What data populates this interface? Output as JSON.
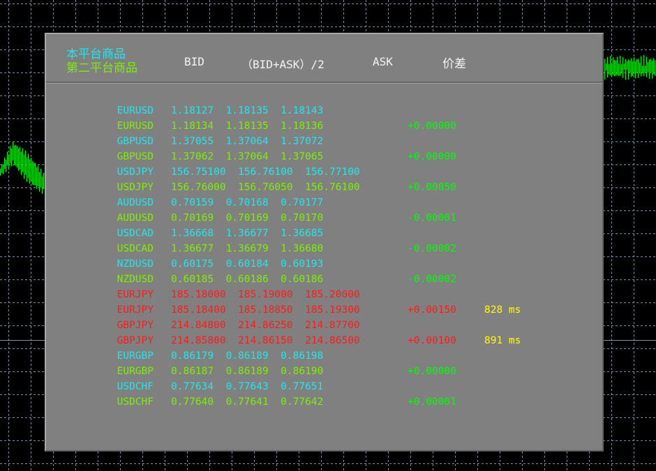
{
  "header": {
    "title_primary": "本平台商品",
    "title_secondary": "第二平台商品",
    "col_bid": "BID",
    "col_mid": "（BID+ASK）/2",
    "col_ask": "ASK",
    "col_spread": "价差"
  },
  "colors": {
    "primary": "#1ee8ee",
    "secondary": "#7cf000",
    "alert": "#ff1a1a",
    "spread": "#00ff00",
    "latency": "#ffff00",
    "panel": "#808080"
  },
  "rows": [
    {
      "symbol": "EURUSD",
      "bid": "1.18127",
      "mid": "1.18135",
      "ask": "1.18143",
      "spread": "",
      "latency": "",
      "kind": "primary"
    },
    {
      "symbol": "EURUSD",
      "bid": "1.18134",
      "mid": "1.18135",
      "ask": "1.18136",
      "spread": "+0.00000",
      "latency": "",
      "kind": "secondary"
    },
    {
      "symbol": "GBPUSD",
      "bid": "1.37055",
      "mid": "1.37064",
      "ask": "1.37072",
      "spread": "",
      "latency": "",
      "kind": "primary"
    },
    {
      "symbol": "GBPUSD",
      "bid": "1.37062",
      "mid": "1.37064",
      "ask": "1.37065",
      "spread": "+0.00000",
      "latency": "",
      "kind": "secondary"
    },
    {
      "symbol": "USDJPY",
      "bid": "156.75100",
      "mid": "156.76100",
      "ask": "156.77100",
      "spread": "",
      "latency": "",
      "kind": "primary"
    },
    {
      "symbol": "USDJPY",
      "bid": "156.76000",
      "mid": "156.76050",
      "ask": "156.76100",
      "spread": "+0.00050",
      "latency": "",
      "kind": "secondary"
    },
    {
      "symbol": "AUDUSD",
      "bid": "0.70159",
      "mid": "0.70168",
      "ask": "0.70177",
      "spread": "",
      "latency": "",
      "kind": "primary"
    },
    {
      "symbol": "AUDUSD",
      "bid": "0.70169",
      "mid": "0.70169",
      "ask": "0.70170",
      "spread": "-0.00001",
      "latency": "",
      "kind": "secondary"
    },
    {
      "symbol": "USDCAD",
      "bid": "1.36668",
      "mid": "1.36677",
      "ask": "1.36685",
      "spread": "",
      "latency": "",
      "kind": "primary"
    },
    {
      "symbol": "USDCAD",
      "bid": "1.36677",
      "mid": "1.36679",
      "ask": "1.36680",
      "spread": "-0.00002",
      "latency": "",
      "kind": "secondary"
    },
    {
      "symbol": "NZDUSD",
      "bid": "0.60175",
      "mid": "0.60184",
      "ask": "0.60193",
      "spread": "",
      "latency": "",
      "kind": "primary"
    },
    {
      "symbol": "NZDUSD",
      "bid": "0.60185",
      "mid": "0.60186",
      "ask": "0.60186",
      "spread": "-0.00002",
      "latency": "",
      "kind": "secondary"
    },
    {
      "symbol": "EURJPY",
      "bid": "185.18000",
      "mid": "185.19000",
      "ask": "185.20000",
      "spread": "",
      "latency": "",
      "kind": "alert"
    },
    {
      "symbol": "EURJPY",
      "bid": "185.18400",
      "mid": "185.18850",
      "ask": "185.19300",
      "spread": "+0.00150",
      "latency": "828 ms",
      "kind": "alert"
    },
    {
      "symbol": "GBPJPY",
      "bid": "214.84800",
      "mid": "214.86250",
      "ask": "214.87700",
      "spread": "",
      "latency": "",
      "kind": "alert"
    },
    {
      "symbol": "GBPJPY",
      "bid": "214.85800",
      "mid": "214.86150",
      "ask": "214.86500",
      "spread": "+0.00100",
      "latency": "891 ms",
      "kind": "alert"
    },
    {
      "symbol": "EURGBP",
      "bid": "0.86179",
      "mid": "0.86189",
      "ask": "0.86198",
      "spread": "",
      "latency": "",
      "kind": "primary"
    },
    {
      "symbol": "EURGBP",
      "bid": "0.86187",
      "mid": "0.86189",
      "ask": "0.86190",
      "spread": "+0.00000",
      "latency": "",
      "kind": "secondary"
    },
    {
      "symbol": "USDCHF",
      "bid": "0.77634",
      "mid": "0.77643",
      "ask": "0.77651",
      "spread": "",
      "latency": "",
      "kind": "primary"
    },
    {
      "symbol": "USDCHF",
      "bid": "0.77640",
      "mid": "0.77641",
      "ask": "0.77642",
      "spread": "+0.00001",
      "latency": "",
      "kind": "secondary"
    }
  ]
}
